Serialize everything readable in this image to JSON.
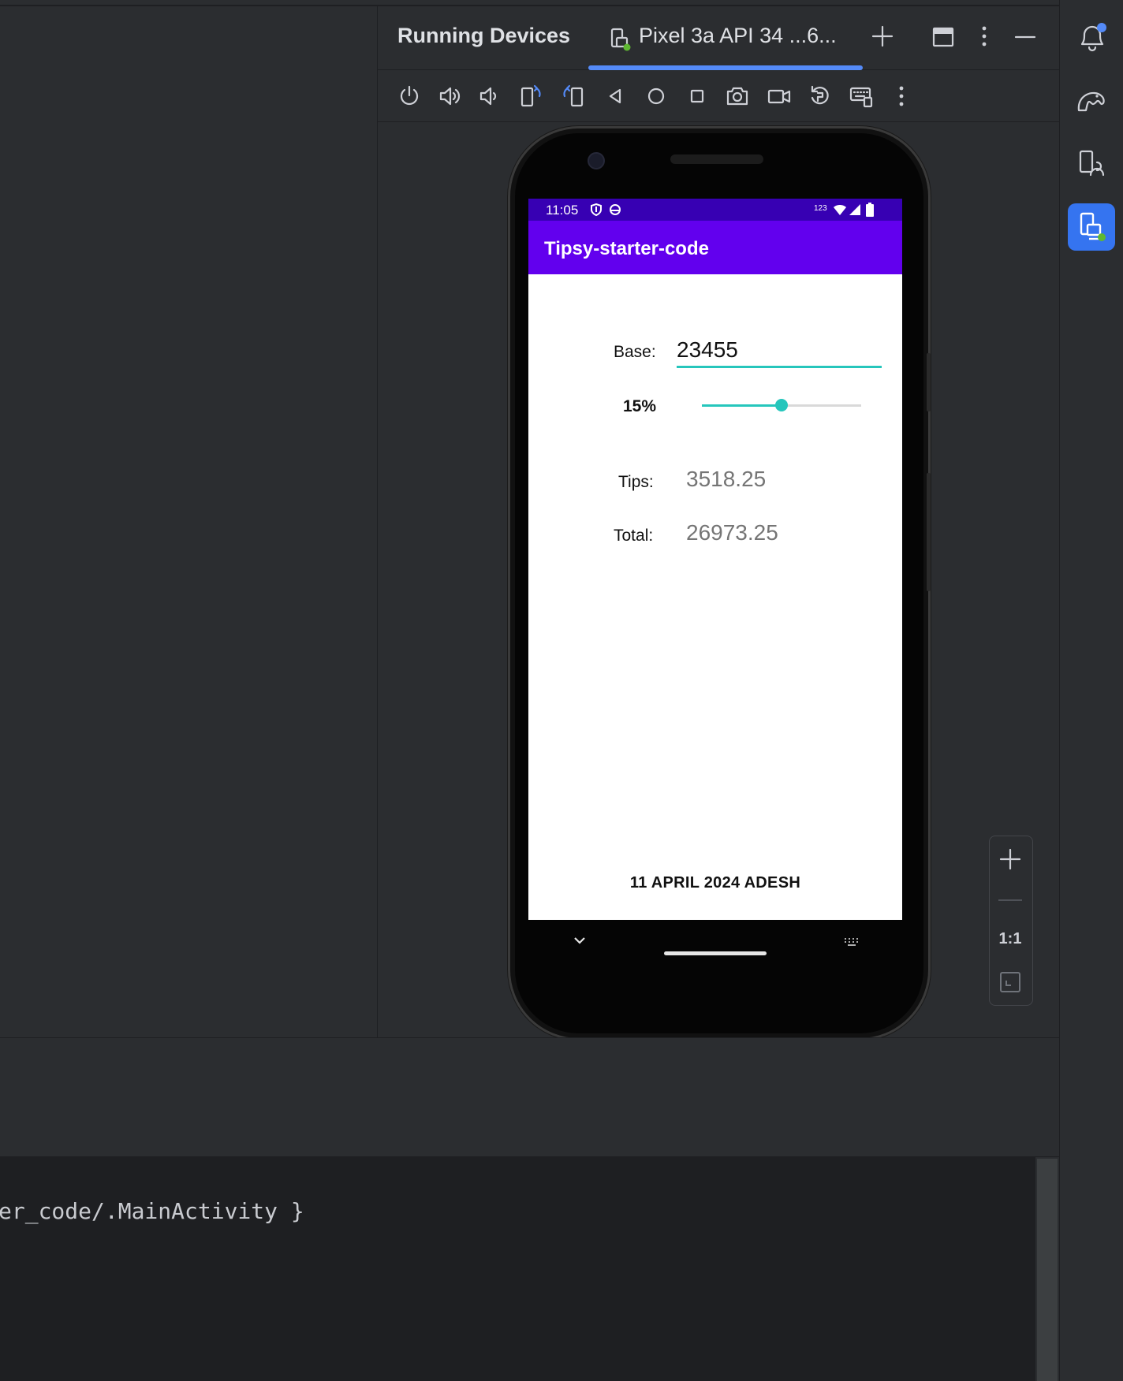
{
  "panel": {
    "title": "Running Devices",
    "device_tab_label": "Pixel 3a API 34 ...6..."
  },
  "toolbar": {
    "buttons": [
      "power-icon",
      "volume-up-icon",
      "volume-down-icon",
      "rotate-left-icon",
      "rotate-right-icon",
      "back-icon",
      "home-icon",
      "overview-icon",
      "screenshot-icon",
      "screen-record-icon",
      "reset-icon",
      "keyboard-icon",
      "more-icon"
    ]
  },
  "right_strip": {
    "buttons": [
      "notifications-icon",
      "gradle-elephant-icon",
      "device-manager-icon",
      "running-devices-icon"
    ]
  },
  "device": {
    "status_time": "11:05",
    "status_right": "123",
    "app_title": "Tipsy-starter-code",
    "base_label": "Base:",
    "base_value": "23455",
    "tip_percent_label": "15%",
    "tip_percent": 15,
    "slider_fraction": 0.5,
    "tips_label": "Tips:",
    "tips_value": "3518.25",
    "total_label": "Total:",
    "total_value": "26973.25",
    "footer": "11 APRIL 2024 ADESH"
  },
  "zoom": {
    "actual_size_label": "1:1"
  },
  "console": {
    "line": "er_code/.MainActivity }"
  },
  "colors": {
    "accent_blue": "#548af7",
    "app_bar": "#6200ee",
    "status_bar": "#3700b3",
    "teal": "#26c6bc",
    "ide_bg": "#2b2d30"
  }
}
